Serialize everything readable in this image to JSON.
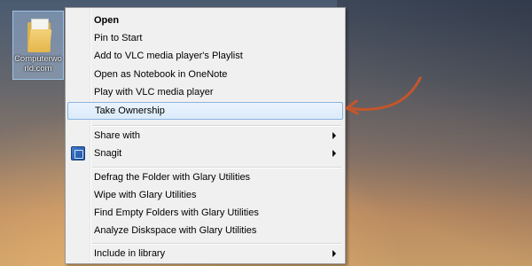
{
  "desktop": {
    "icon_label": "Computerworld.com"
  },
  "context_menu": {
    "items": [
      {
        "label": "Open",
        "bold": true
      },
      {
        "label": "Pin to Start"
      },
      {
        "label": "Add to VLC media player's Playlist"
      },
      {
        "label": "Open as Notebook in OneNote"
      },
      {
        "label": "Play with VLC media player"
      },
      {
        "label": "Take Ownership",
        "highlighted": true
      },
      {
        "label": "Share with",
        "submenu": true
      },
      {
        "label": "Snagit",
        "submenu": true,
        "icon": "snagit-icon"
      },
      {
        "label": "Defrag the Folder with Glary Utilities"
      },
      {
        "label": "Wipe with Glary Utilities"
      },
      {
        "label": "Find Empty Folders with Glary Utilities"
      },
      {
        "label": "Analyze Diskspace with Glary Utilities"
      },
      {
        "label": "Include in library",
        "submenu": true
      }
    ]
  },
  "colors": {
    "highlight_border": "#8bb3de",
    "annotation_arrow": "#c2562b"
  }
}
